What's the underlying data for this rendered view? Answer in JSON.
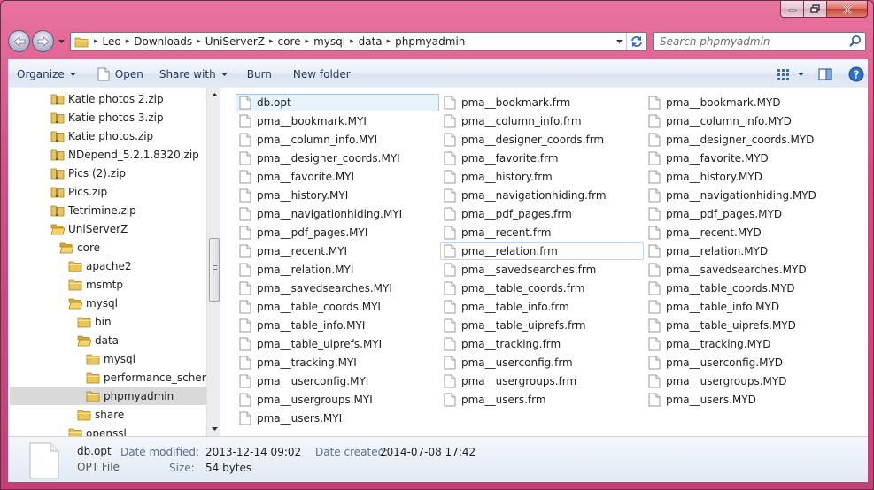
{
  "address": {
    "crumbs": [
      "Leo",
      "Downloads",
      "UniServerZ",
      "core",
      "mysql",
      "data",
      "phpmyadmin"
    ]
  },
  "search": {
    "placeholder": "Search phpmyadmin"
  },
  "toolbar": {
    "organize": "Organize",
    "open": "Open",
    "share_with": "Share with",
    "burn": "Burn",
    "new_folder": "New folder"
  },
  "tree": [
    {
      "label": "Katie photos 2.zip",
      "icon": "zip-folder-icon",
      "level": 2
    },
    {
      "label": "Katie photos 3.zip",
      "icon": "zip-folder-icon",
      "level": 2
    },
    {
      "label": "Katie photos.zip",
      "icon": "zip-folder-icon",
      "level": 2
    },
    {
      "label": "NDepend_5.2.1.8320.zip",
      "icon": "zip-folder-icon",
      "level": 2
    },
    {
      "label": "Pics (2).zip",
      "icon": "zip-folder-icon",
      "level": 2
    },
    {
      "label": "Pics.zip",
      "icon": "zip-folder-icon",
      "level": 2
    },
    {
      "label": "Tetrimine.zip",
      "icon": "zip-folder-icon",
      "level": 2
    },
    {
      "label": "UniServerZ",
      "icon": "open-folder-icon",
      "level": 2
    },
    {
      "label": "core",
      "icon": "open-folder-icon",
      "level": 3
    },
    {
      "label": "apache2",
      "icon": "folder-icon",
      "level": 4
    },
    {
      "label": "msmtp",
      "icon": "folder-icon",
      "level": 4
    },
    {
      "label": "mysql",
      "icon": "open-folder-icon",
      "level": 4
    },
    {
      "label": "bin",
      "icon": "folder-icon",
      "level": 5
    },
    {
      "label": "data",
      "icon": "open-folder-icon",
      "level": 5
    },
    {
      "label": "mysql",
      "icon": "folder-icon",
      "level": 6
    },
    {
      "label": "performance_schema",
      "icon": "folder-icon",
      "level": 6
    },
    {
      "label": "phpmyadmin",
      "icon": "folder-icon",
      "level": 6,
      "selected": true
    },
    {
      "label": "share",
      "icon": "folder-icon",
      "level": 5
    },
    {
      "label": "openssl",
      "icon": "folder-icon",
      "level": 4
    }
  ],
  "files": {
    "col1": [
      "db.opt",
      "pma__bookmark.MYI",
      "pma__column_info.MYI",
      "pma__designer_coords.MYI",
      "pma__favorite.MYI",
      "pma__history.MYI",
      "pma__navigationhiding.MYI",
      "pma__pdf_pages.MYI",
      "pma__recent.MYI",
      "pma__relation.MYI",
      "pma__savedsearches.MYI",
      "pma__table_coords.MYI",
      "pma__table_info.MYI",
      "pma__table_uiprefs.MYI",
      "pma__tracking.MYI",
      "pma__userconfig.MYI",
      "pma__usergroups.MYI",
      "pma__users.MYI"
    ],
    "col2": [
      "pma__bookmark.frm",
      "pma__column_info.frm",
      "pma__designer_coords.frm",
      "pma__favorite.frm",
      "pma__history.frm",
      "pma__navigationhiding.frm",
      "pma__pdf_pages.frm",
      "pma__recent.frm",
      "pma__relation.frm",
      "pma__savedsearches.frm",
      "pma__table_coords.frm",
      "pma__table_info.frm",
      "pma__table_uiprefs.frm",
      "pma__tracking.frm",
      "pma__userconfig.frm",
      "pma__usergroups.frm",
      "pma__users.frm"
    ],
    "col3": [
      "pma__bookmark.MYD",
      "pma__column_info.MYD",
      "pma__designer_coords.MYD",
      "pma__favorite.MYD",
      "pma__history.MYD",
      "pma__navigationhiding.MYD",
      "pma__pdf_pages.MYD",
      "pma__recent.MYD",
      "pma__relation.MYD",
      "pma__savedsearches.MYD",
      "pma__table_coords.MYD",
      "pma__table_info.MYD",
      "pma__table_uiprefs.MYD",
      "pma__tracking.MYD",
      "pma__userconfig.MYD",
      "pma__usergroups.MYD",
      "pma__users.MYD"
    ]
  },
  "selected_file": "db.opt",
  "hover_file": "pma__relation.frm",
  "details": {
    "name": "db.opt",
    "type": "OPT File",
    "date_modified_label": "Date modified:",
    "date_modified": "2013-12-14 09:02",
    "size_label": "Size:",
    "size": "54 bytes",
    "date_created_label": "Date created:",
    "date_created": "2014-07-08 17:42"
  },
  "colors": {
    "title_bar": "#d24e83",
    "selection": "#e6f2fc",
    "command_text": "#1e395b"
  }
}
